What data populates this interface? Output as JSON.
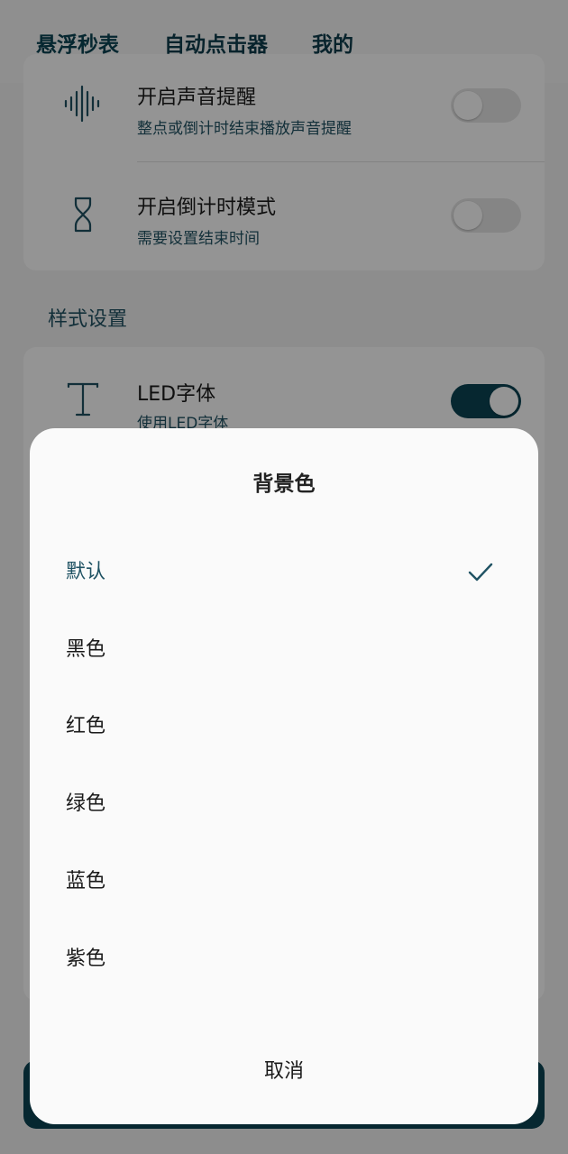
{
  "tabs": [
    "悬浮秒表",
    "自动点击器",
    "我的"
  ],
  "card1": {
    "sound": {
      "title": "开启声音提醒",
      "subtitle": "整点或倒计时结束播放声音提醒"
    },
    "countdown": {
      "title": "开启倒计时模式",
      "subtitle": "需要设置结束时间"
    }
  },
  "section_label": "样式设置",
  "card2": {
    "led": {
      "title": "LED字体",
      "subtitle": "使用LED字体"
    }
  },
  "dialog": {
    "title": "背景色",
    "options": [
      "默认",
      "黑色",
      "红色",
      "绿色",
      "蓝色",
      "紫色"
    ],
    "selected_index": 0,
    "cancel": "取消"
  },
  "colors": {
    "accent": "#0b4454",
    "text": "#1a1a1a"
  }
}
